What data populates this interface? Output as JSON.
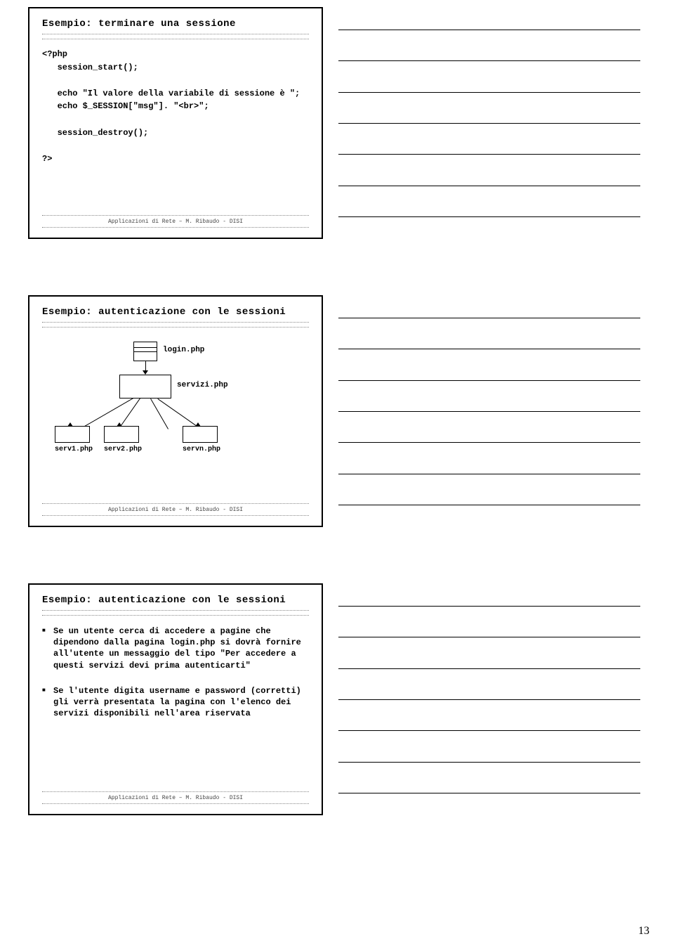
{
  "slide1": {
    "title": "Esempio: terminare una sessione",
    "code_l1": "<?php",
    "code_l2": "   session_start();",
    "code_l3": "   echo \"Il valore della variabile di sessione è \";",
    "code_l4": "   echo $_SESSION[\"msg\"]. \"<br>\";",
    "code_l5": "   session_destroy();",
    "code_l6": "?>",
    "footer": "Applicazioni di Rete – M. Ribaudo - DISI"
  },
  "slide2": {
    "title": "Esempio: autenticazione con le sessioni",
    "label_login": "login.php",
    "label_servizi": "servizi.php",
    "label_serv1": "serv1.php",
    "label_serv2": "serv2.php",
    "label_servn": "servn.php",
    "footer": "Applicazioni di Rete – M. Ribaudo - DISI"
  },
  "slide3": {
    "title": "Esempio: autenticazione con le sessioni",
    "bullet1": "Se un utente cerca di accedere a pagine che dipendono dalla pagina login.php si dovrà fornire all'utente un messaggio del tipo \"Per accedere a questi servizi devi prima autenticarti\"",
    "bullet2": "Se l'utente digita username e password (corretti) gli verrà presentata la pagina con l'elenco dei servizi disponibili nell'area riservata",
    "footer": "Applicazioni di Rete – M. Ribaudo - DISI"
  },
  "page_number": "13"
}
